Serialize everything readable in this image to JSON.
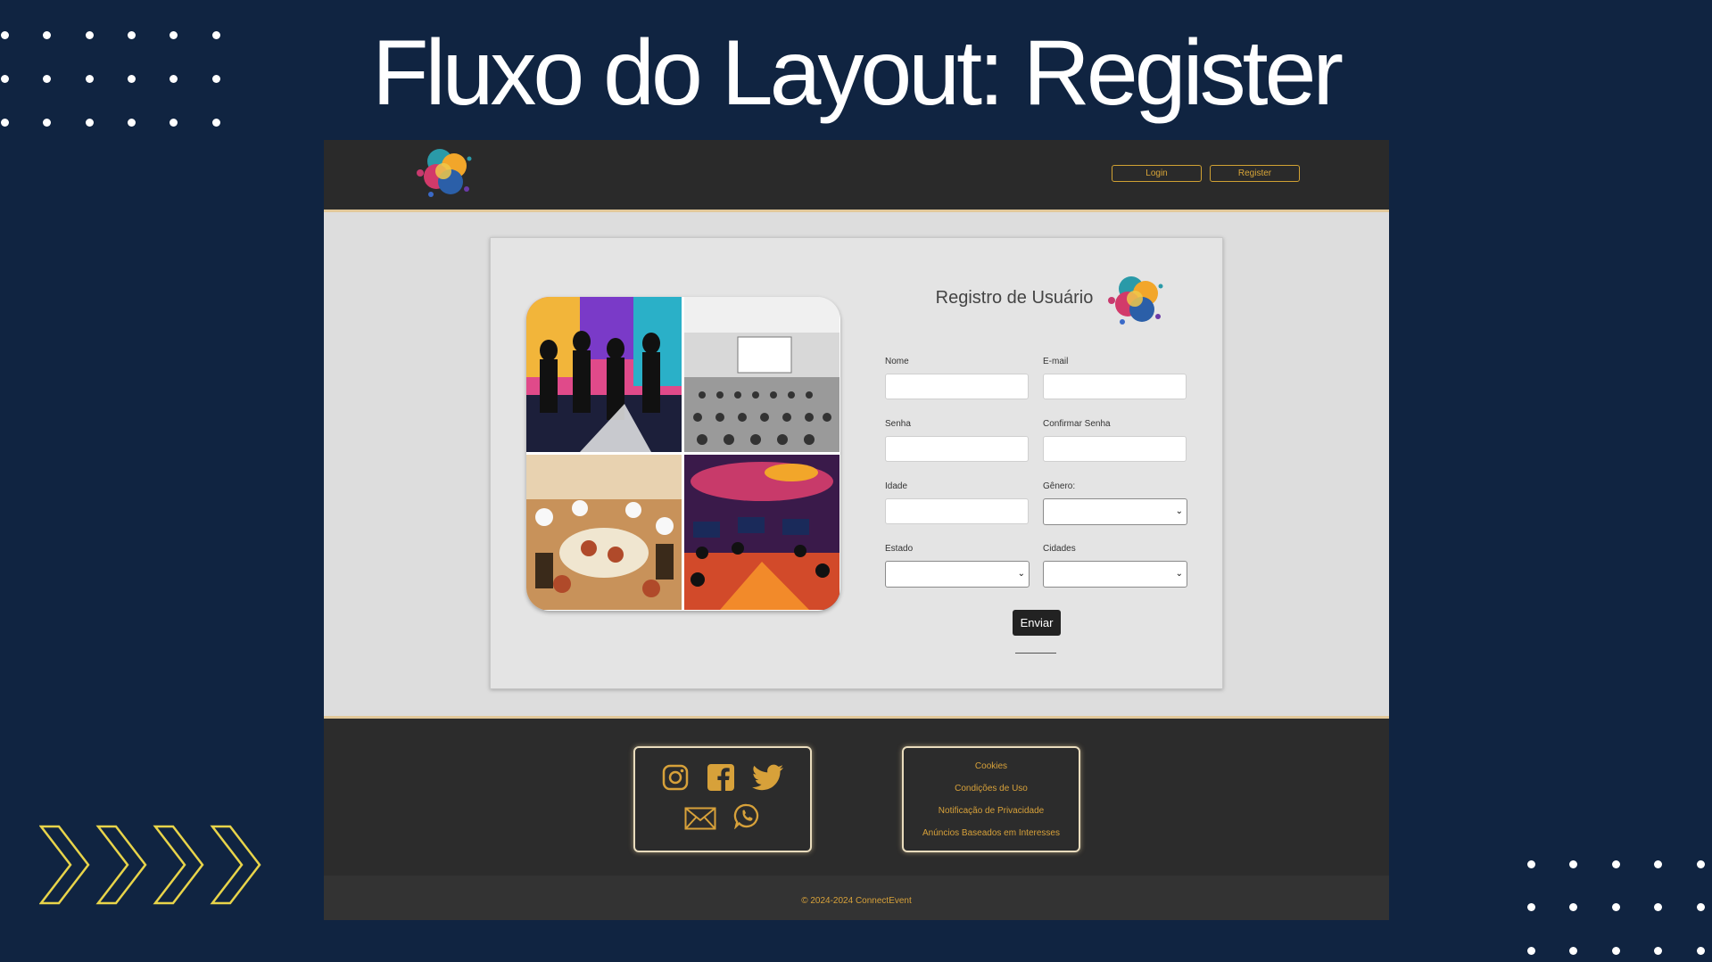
{
  "slide": {
    "title": "Fluxo do Layout: Register"
  },
  "header": {
    "nav": {
      "login": "Login",
      "register": "Register"
    }
  },
  "form": {
    "title": "Registro de Usuário",
    "fields": {
      "nome": "Nome",
      "email": "E-mail",
      "senha": "Senha",
      "confirmar_senha": "Confirmar Senha",
      "idade": "Idade",
      "genero": "Gênero:",
      "estado": "Estado",
      "cidades": "Cidades"
    },
    "submit": "Enviar"
  },
  "footer": {
    "social_icons": [
      "instagram-icon",
      "facebook-icon",
      "twitter-icon",
      "email-icon",
      "whatsapp-icon"
    ],
    "links": [
      "Cookies",
      "Condições de Uso",
      "Notificação de Privacidade",
      "Anúncios Baseados em Interesses"
    ],
    "copyright": "© 2024-2024 ConnectEvent"
  },
  "colors": {
    "slide_bg": "#102441",
    "header_bg": "#2a2a2a",
    "accent": "#d7a13a",
    "accent_border": "#e2c89a",
    "chevron": "#e8d44a"
  }
}
